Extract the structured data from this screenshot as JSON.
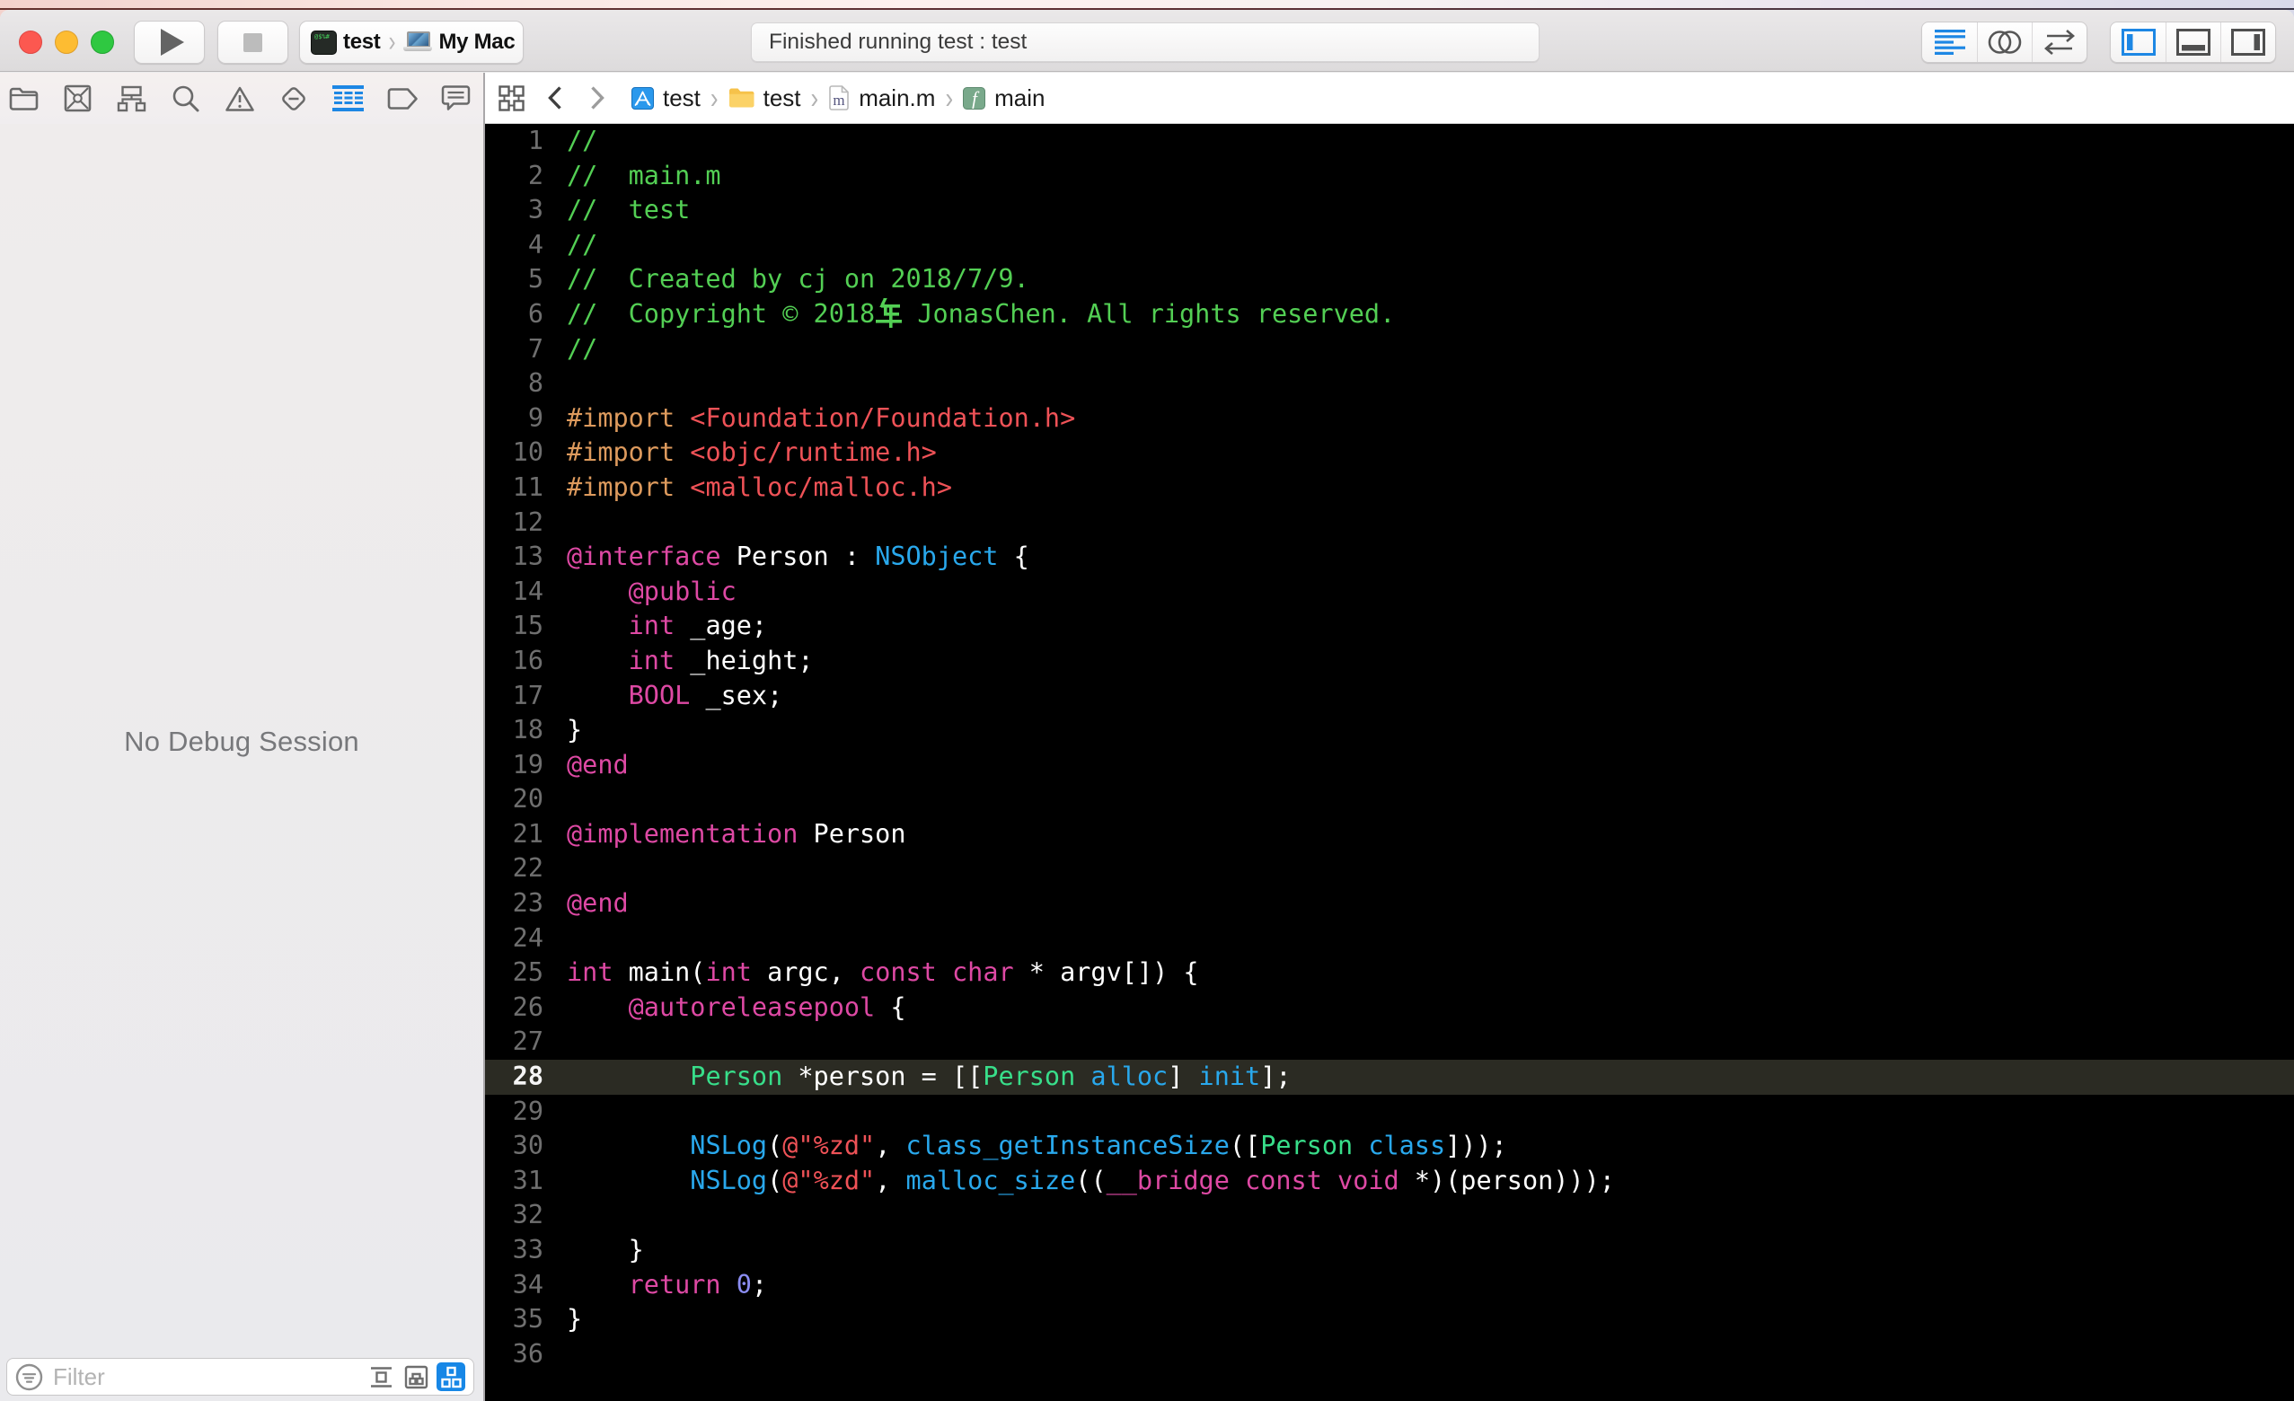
{
  "window_title_area": {
    "traffic_lights": [
      "close-button",
      "minimize-button",
      "zoom-button"
    ],
    "run_button": "run",
    "stop_button": "stop",
    "scheme": {
      "project": "test",
      "destination": "My Mac"
    },
    "status": "Finished running test : test",
    "editor_mode_buttons": [
      "standard-editor",
      "assistant-editor",
      "version-editor"
    ],
    "panel_toggle_buttons": [
      "navigator-panel",
      "debug-area",
      "inspector-panel"
    ]
  },
  "navigator": {
    "tabs": [
      "project",
      "source-control",
      "symbols",
      "find",
      "issues",
      "tests",
      "debug",
      "breakpoints",
      "reports"
    ],
    "selected_tab": "debug",
    "empty_message": "No Debug Session",
    "filter": {
      "placeholder": "Filter",
      "view_buttons": [
        "flat-list",
        "grouped",
        "hierarchy"
      ],
      "active_view_button": "hierarchy"
    }
  },
  "jumpbar": {
    "items": [
      {
        "icon": "project-icon",
        "label": "test"
      },
      {
        "icon": "group-folder-icon",
        "label": "test"
      },
      {
        "icon": "objc-file-icon",
        "label": "main.m"
      },
      {
        "icon": "function-icon",
        "label": "main"
      }
    ]
  },
  "editor": {
    "language": "objective-c",
    "highlighted_line": 28,
    "lines": [
      {
        "n": 1,
        "tokens": [
          [
            "c",
            "//"
          ]
        ]
      },
      {
        "n": 2,
        "tokens": [
          [
            "c",
            "//  main.m"
          ]
        ]
      },
      {
        "n": 3,
        "tokens": [
          [
            "c",
            "//  test"
          ]
        ]
      },
      {
        "n": 4,
        "tokens": [
          [
            "c",
            "//"
          ]
        ]
      },
      {
        "n": 5,
        "tokens": [
          [
            "c",
            "//  Created by cj on 2018/7/9."
          ]
        ]
      },
      {
        "n": 6,
        "tokens": [
          [
            "c",
            "//  Copyright © 2018年 JonasChen. All rights reserved."
          ]
        ]
      },
      {
        "n": 7,
        "tokens": [
          [
            "c",
            "//"
          ]
        ]
      },
      {
        "n": 8,
        "tokens": []
      },
      {
        "n": 9,
        "tokens": [
          [
            "p",
            "#import"
          ],
          [
            "w",
            " "
          ],
          [
            "s",
            "<Foundation/Foundation.h>"
          ]
        ]
      },
      {
        "n": 10,
        "tokens": [
          [
            "p",
            "#import"
          ],
          [
            "w",
            " "
          ],
          [
            "s",
            "<objc/runtime.h>"
          ]
        ]
      },
      {
        "n": 11,
        "tokens": [
          [
            "p",
            "#import"
          ],
          [
            "w",
            " "
          ],
          [
            "s",
            "<malloc/malloc.h>"
          ]
        ]
      },
      {
        "n": 12,
        "tokens": []
      },
      {
        "n": 13,
        "tokens": [
          [
            "k",
            "@interface"
          ],
          [
            "w",
            " Person : "
          ],
          [
            "f",
            "NSObject"
          ],
          [
            "w",
            " {"
          ]
        ]
      },
      {
        "n": 14,
        "tokens": [
          [
            "w",
            "    "
          ],
          [
            "k",
            "@public"
          ]
        ]
      },
      {
        "n": 15,
        "tokens": [
          [
            "w",
            "    "
          ],
          [
            "k",
            "int"
          ],
          [
            "w",
            " _age;"
          ]
        ]
      },
      {
        "n": 16,
        "tokens": [
          [
            "w",
            "    "
          ],
          [
            "k",
            "int"
          ],
          [
            "w",
            " _height;"
          ]
        ]
      },
      {
        "n": 17,
        "tokens": [
          [
            "w",
            "    "
          ],
          [
            "k",
            "BOOL"
          ],
          [
            "w",
            " _sex;"
          ]
        ]
      },
      {
        "n": 18,
        "tokens": [
          [
            "w",
            "}"
          ]
        ]
      },
      {
        "n": 19,
        "tokens": [
          [
            "k",
            "@end"
          ]
        ]
      },
      {
        "n": 20,
        "tokens": []
      },
      {
        "n": 21,
        "tokens": [
          [
            "k",
            "@implementation"
          ],
          [
            "w",
            " Person"
          ]
        ]
      },
      {
        "n": 22,
        "tokens": []
      },
      {
        "n": 23,
        "tokens": [
          [
            "k",
            "@end"
          ]
        ]
      },
      {
        "n": 24,
        "tokens": []
      },
      {
        "n": 25,
        "tokens": [
          [
            "k",
            "int"
          ],
          [
            "w",
            " main("
          ],
          [
            "k",
            "int"
          ],
          [
            "w",
            " argc, "
          ],
          [
            "k",
            "const"
          ],
          [
            "w",
            " "
          ],
          [
            "k",
            "char"
          ],
          [
            "w",
            " * argv[]) {"
          ]
        ]
      },
      {
        "n": 26,
        "tokens": [
          [
            "w",
            "    "
          ],
          [
            "k",
            "@autoreleasepool"
          ],
          [
            "w",
            " {"
          ]
        ]
      },
      {
        "n": 27,
        "tokens": []
      },
      {
        "n": 28,
        "tokens": [
          [
            "w",
            "        "
          ],
          [
            "t",
            "Person"
          ],
          [
            "w",
            " *person = [["
          ],
          [
            "t",
            "Person"
          ],
          [
            "w",
            " "
          ],
          [
            "f",
            "alloc"
          ],
          [
            "w",
            "] "
          ],
          [
            "f",
            "init"
          ],
          [
            "w",
            "];"
          ]
        ]
      },
      {
        "n": 29,
        "tokens": []
      },
      {
        "n": 30,
        "tokens": [
          [
            "w",
            "        "
          ],
          [
            "f",
            "NSLog"
          ],
          [
            "w",
            "("
          ],
          [
            "s",
            "@\"%zd\""
          ],
          [
            "w",
            ", "
          ],
          [
            "f",
            "class_getInstanceSize"
          ],
          [
            "w",
            "(["
          ],
          [
            "t",
            "Person"
          ],
          [
            "w",
            " "
          ],
          [
            "f",
            "class"
          ],
          [
            "w",
            "]));"
          ]
        ]
      },
      {
        "n": 31,
        "tokens": [
          [
            "w",
            "        "
          ],
          [
            "f",
            "NSLog"
          ],
          [
            "w",
            "("
          ],
          [
            "s",
            "@\"%zd\""
          ],
          [
            "w",
            ", "
          ],
          [
            "f",
            "malloc_size"
          ],
          [
            "w",
            "(("
          ],
          [
            "k",
            "__bridge"
          ],
          [
            "w",
            " "
          ],
          [
            "k",
            "const"
          ],
          [
            "w",
            " "
          ],
          [
            "k",
            "void"
          ],
          [
            "w",
            " *)(person)));"
          ]
        ]
      },
      {
        "n": 32,
        "tokens": []
      },
      {
        "n": 33,
        "tokens": [
          [
            "w",
            "    }"
          ]
        ]
      },
      {
        "n": 34,
        "tokens": [
          [
            "w",
            "    "
          ],
          [
            "k",
            "return"
          ],
          [
            "w",
            " "
          ],
          [
            "n2",
            "0"
          ],
          [
            "w",
            ";"
          ]
        ]
      },
      {
        "n": 35,
        "tokens": [
          [
            "w",
            "}"
          ]
        ]
      },
      {
        "n": 36,
        "tokens": []
      }
    ]
  },
  "colors": {
    "accent_blue": "#1d87e4",
    "editor_background": "#000000",
    "highlight_row": "#2b2b23",
    "comment": "#53cf54",
    "preprocessor": "#dd9a5d",
    "string": "#ef5257",
    "keyword": "#de49a4",
    "project_class": "#38de8a",
    "framework_symbol": "#29a8ec",
    "number": "#8b8df2"
  }
}
